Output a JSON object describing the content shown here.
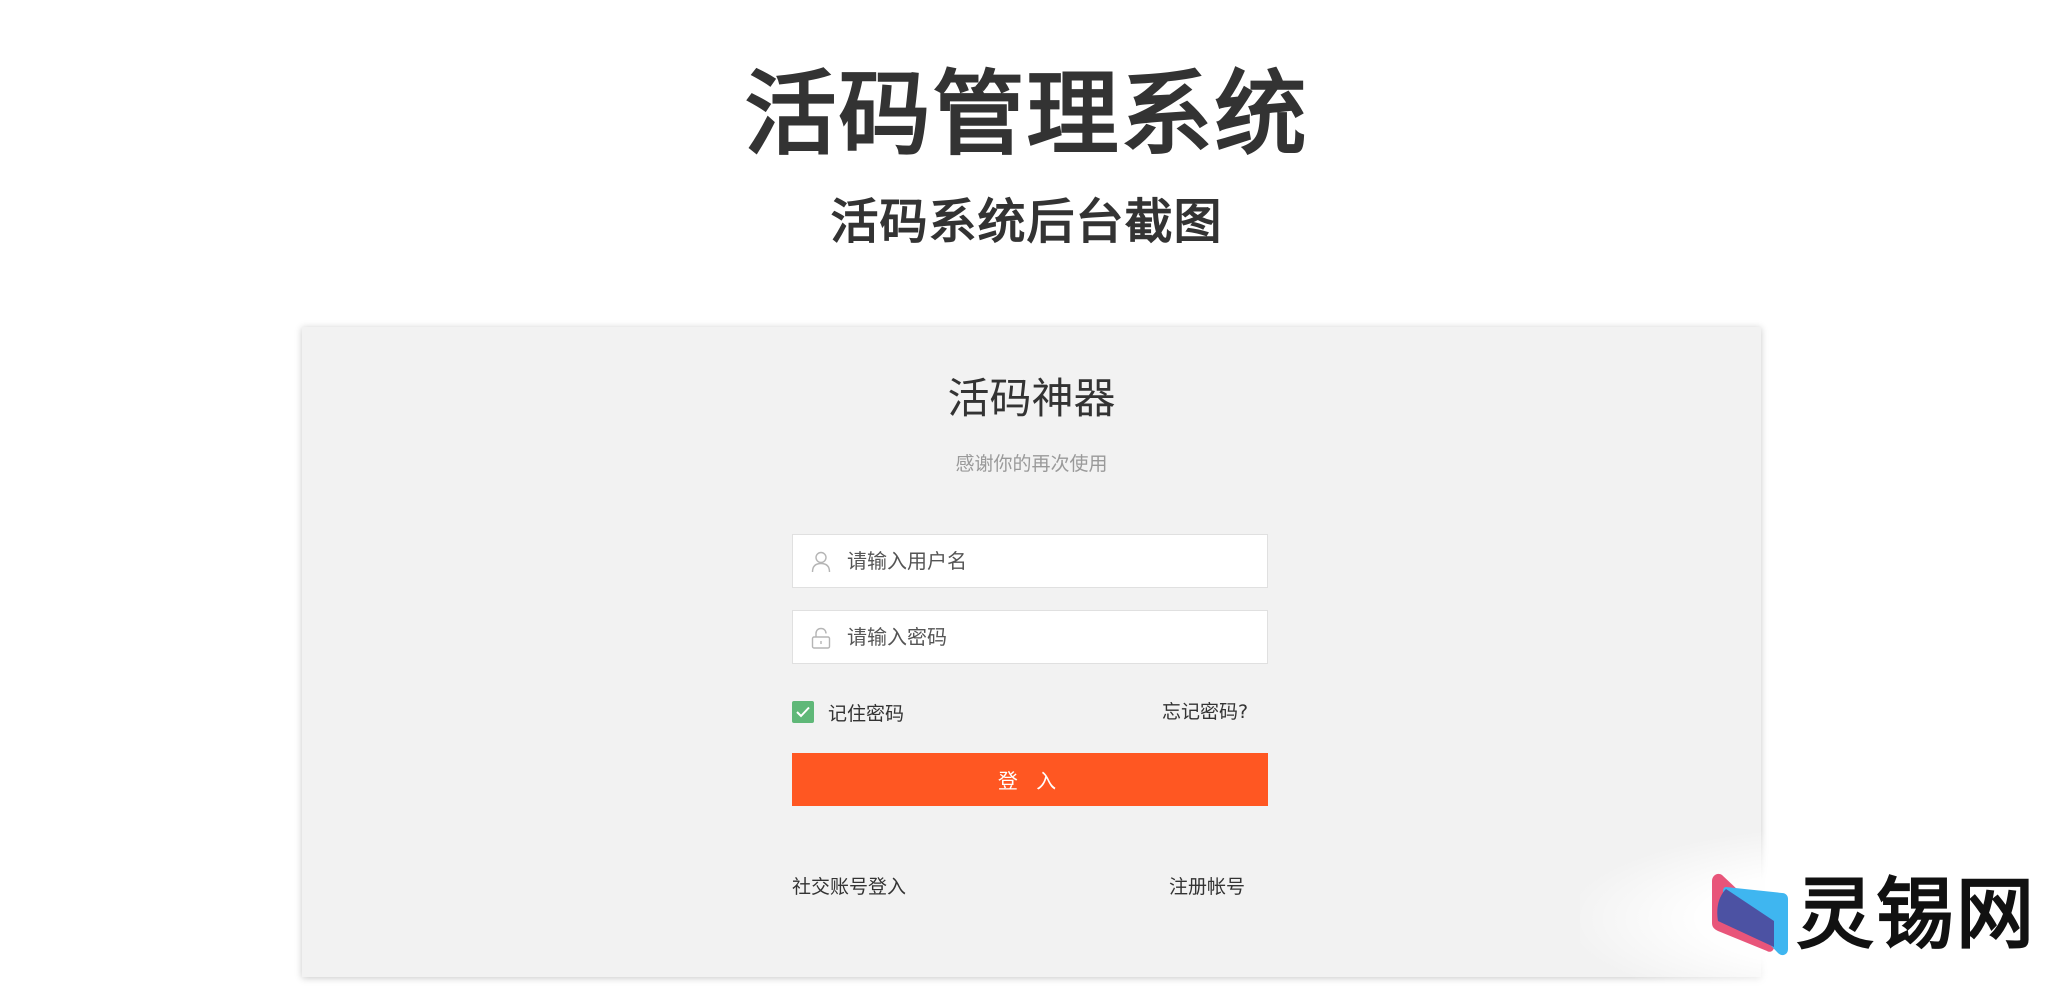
{
  "header": {
    "title": "活码管理系统",
    "subtitle": "活码系统后台截图"
  },
  "login_card": {
    "title": "活码神器",
    "subtitle": "感谢你的再次使用",
    "username_placeholder": "请输入用户名",
    "password_placeholder": "请输入密码",
    "remember_label": "记住密码",
    "remember_checked": true,
    "forgot_link": "忘记密码?",
    "login_button": "登 入",
    "social_login": "社交账号登入",
    "register_link": "注册帐号"
  },
  "colors": {
    "accent": "#ff5722",
    "checkbox": "#5fb878",
    "card_bg": "#f2f2f2"
  },
  "icons": {
    "username": "user-icon",
    "password": "lock-icon",
    "checkbox": "check-icon"
  },
  "watermark": {
    "text": "灵锡网"
  }
}
